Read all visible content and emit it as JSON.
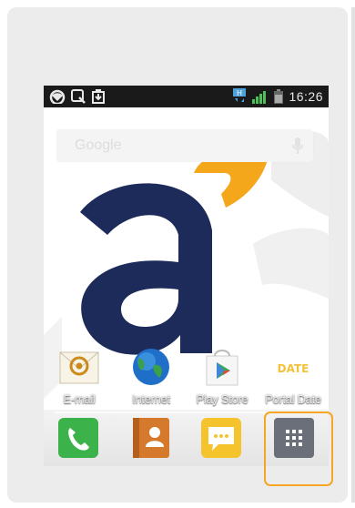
{
  "status": {
    "time": "16:26",
    "network_badge": "H"
  },
  "search": {
    "label": "Google"
  },
  "apps": [
    {
      "label": "E-mail",
      "icon": "email-icon"
    },
    {
      "label": "Internet",
      "icon": "globe-icon"
    },
    {
      "label": "Play Store",
      "icon": "play-store-icon"
    },
    {
      "label": "Portal Date",
      "icon": "portal-date-icon",
      "icon_text": "DATE"
    }
  ],
  "dock": [
    {
      "icon": "phone-icon"
    },
    {
      "icon": "contacts-icon"
    },
    {
      "icon": "messaging-icon"
    },
    {
      "icon": "app-drawer-icon"
    }
  ],
  "colors": {
    "brand_navy": "#1c2b59",
    "brand_orange": "#f4a71a",
    "highlight": "#f5a623"
  }
}
